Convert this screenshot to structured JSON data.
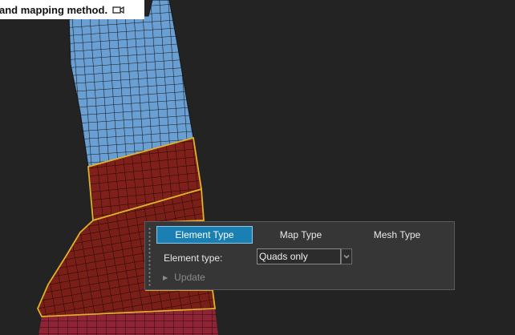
{
  "tooltip": {
    "text": "and mapping method.",
    "icon": "video-camera-icon"
  },
  "panel": {
    "tabs": [
      {
        "label": "Element Type",
        "active": true
      },
      {
        "label": "Map Type",
        "active": false
      },
      {
        "label": "Mesh Type",
        "active": false
      }
    ],
    "element_type_label": "Element type:",
    "element_type_value": "Quads only",
    "update_label": "Update",
    "accent": "#1a7fb2"
  },
  "viewport": {
    "colors": {
      "background": "#232323",
      "blue_mesh": "#6a9fd3",
      "red_mesh": "#80201a",
      "mesh_lines": "#151515",
      "selection_outline": "#e0b22a"
    }
  }
}
